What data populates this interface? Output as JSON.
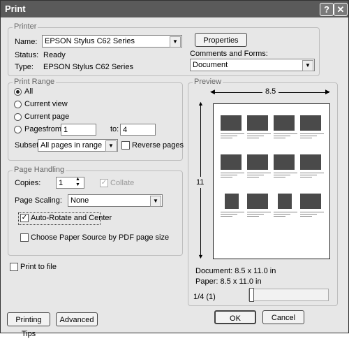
{
  "window": {
    "title": "Print",
    "help_symbol": "?",
    "close_symbol": "✕"
  },
  "printer": {
    "group_label": "Printer",
    "name_label": "Name:",
    "name_value": "EPSON Stylus C62 Series",
    "properties_label": "Properties",
    "status_label": "Status:",
    "status_value": "Ready",
    "type_label": "Type:",
    "type_value": "EPSON Stylus C62 Series",
    "comments_label": "Comments and Forms:",
    "comments_value": "Document"
  },
  "print_range": {
    "group_label": "Print Range",
    "options": [
      "All",
      "Current view",
      "Current page",
      "Pages"
    ],
    "selected": "All",
    "from_label": "from:",
    "from_value": "1",
    "to_label": "to:",
    "to_value": "4",
    "subset_label": "Subset:",
    "subset_value": "All pages in range",
    "reverse_label": "Reverse pages"
  },
  "page_handling": {
    "group_label": "Page Handling",
    "copies_label": "Copies:",
    "copies_value": "1",
    "collate_label": "Collate",
    "scaling_label": "Page Scaling:",
    "scaling_value": "None",
    "autorotate_label": "Auto-Rotate and Center",
    "autorotate_checked": true,
    "paper_source_label": "Choose Paper Source by PDF page size"
  },
  "print_to_file_label": "Print to file",
  "preview": {
    "group_label": "Preview",
    "width_label": "8.5",
    "height_label": "11",
    "document_size": "Document: 8.5 x 11.0 in",
    "paper_size": "Paper: 8.5 x 11.0 in",
    "page_indicator": "1/4 (1)"
  },
  "buttons": {
    "printing_tips": "Printing Tips",
    "advanced": "Advanced",
    "ok": "OK",
    "cancel": "Cancel"
  },
  "icons": {
    "dropdown": "chevron-down-icon",
    "spinner": "spinner-icon"
  }
}
